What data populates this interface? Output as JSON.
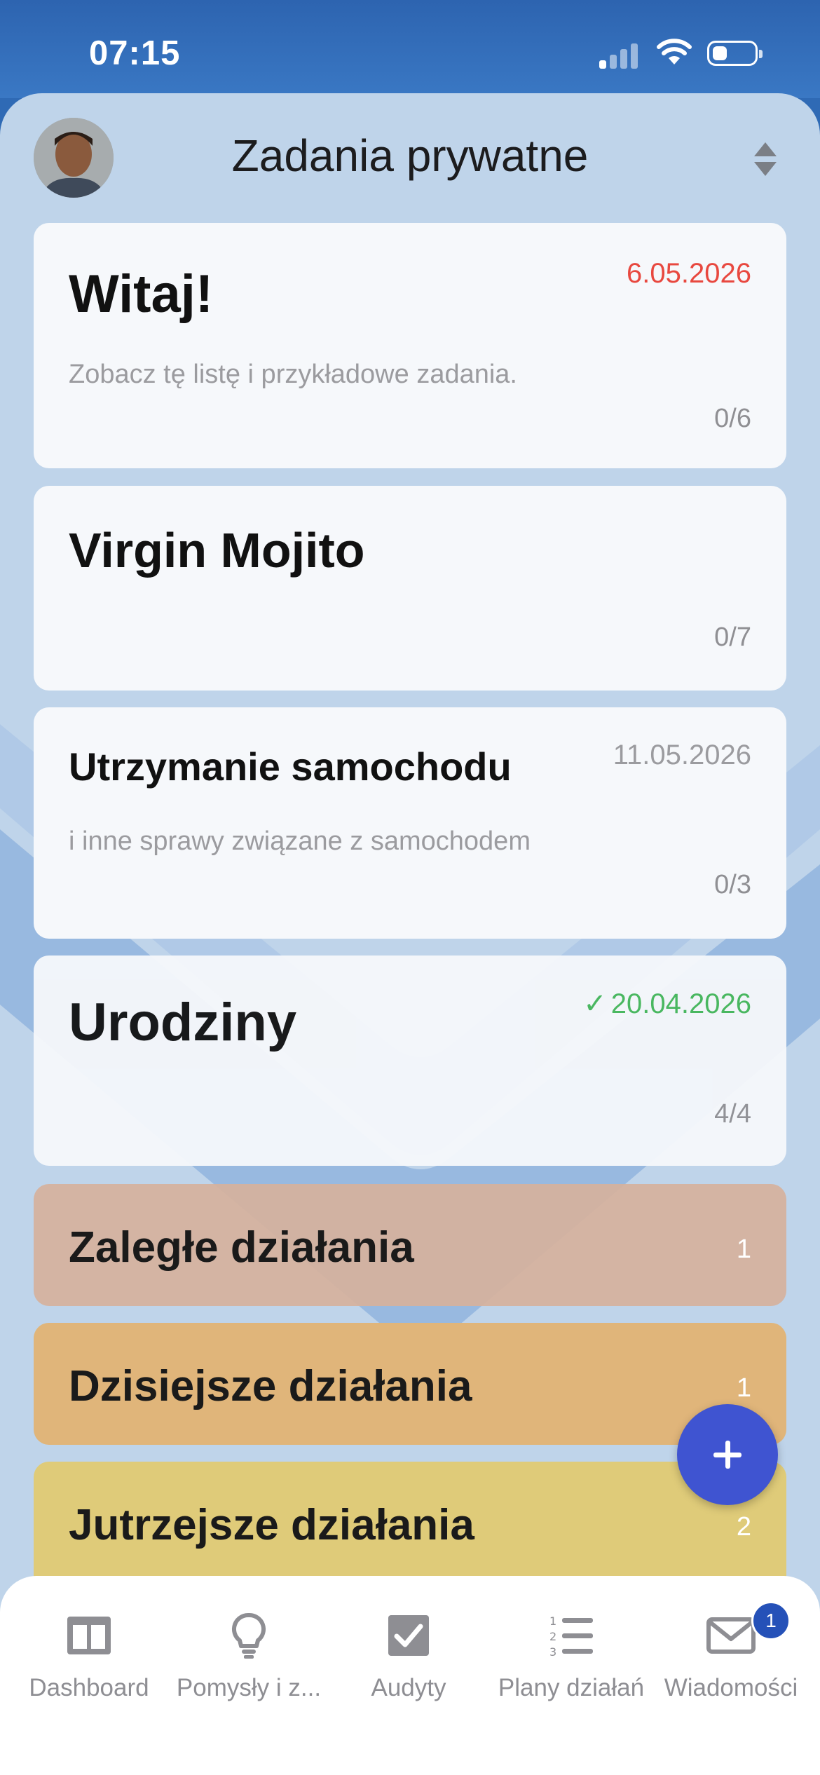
{
  "status_bar": {
    "time": "07:15"
  },
  "header": {
    "title": "Zadania prywatne"
  },
  "cards": [
    {
      "title": "Witaj!",
      "date": "6.05.2026",
      "subtitle": "Zobacz tę listę i przykładowe zadania.",
      "count": "0/6"
    },
    {
      "title": "Virgin Mojito",
      "date": "",
      "subtitle": "",
      "count": "0/7"
    },
    {
      "title": "Utrzymanie samochodu",
      "date": "11.05.2026",
      "subtitle": "i inne sprawy związane z samochodem",
      "count": "0/3"
    },
    {
      "title": "Urodziny",
      "date": "20.04.2026",
      "subtitle": "",
      "count": "4/4"
    }
  ],
  "sections": [
    {
      "title": "Zaległe działania",
      "count": "1"
    },
    {
      "title": "Dzisiejsze działania",
      "count": "1"
    },
    {
      "title": "Jutrzejsze działania",
      "count": "2"
    }
  ],
  "tabbar": {
    "items": [
      {
        "label": "Dashboard",
        "icon": "dashboard-icon"
      },
      {
        "label": "Pomysły i z...",
        "icon": "lightbulb-icon"
      },
      {
        "label": "Audyty",
        "icon": "checkbox-icon"
      },
      {
        "label": "Plany działań",
        "icon": "numbered-list-icon"
      },
      {
        "label": "Wiadomości",
        "icon": "envelope-icon"
      }
    ],
    "messages_badge": "1"
  },
  "colors": {
    "overdue_date": "#e8483f",
    "done_date": "#45b75a",
    "neutral_date": "#9b9b9f",
    "section_overdue": "#d6b19c",
    "section_today": "#e0b57a",
    "section_tomorrow": "#dfcb79",
    "fab": "#3f54d1",
    "badge": "#2551b8"
  }
}
